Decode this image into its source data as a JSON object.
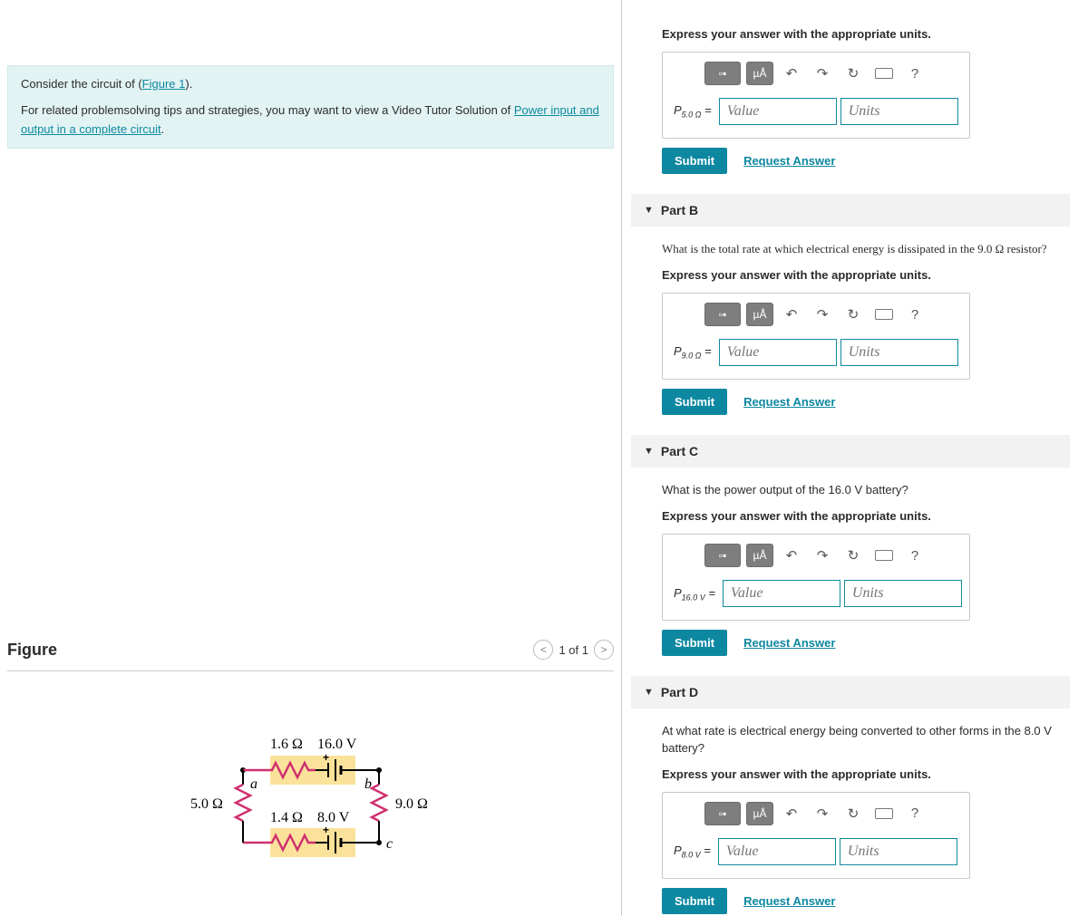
{
  "info": {
    "line1_a": "Consider the circuit of (",
    "figure_link": "Figure 1",
    "line1_b": ").",
    "line2_a": "For related problemsolving tips and strategies, you may want to view a Video Tutor Solution of ",
    "tutor_link": "Power input and output in a complete circuit",
    "line2_b": "."
  },
  "figure": {
    "title": "Figure",
    "pager": "1 of 1",
    "labels": {
      "top_r": "1.6 Ω",
      "top_v": "16.0 V",
      "bot_r": "1.4 Ω",
      "bot_v": "8.0 V",
      "left_r": "5.0 Ω",
      "right_r": "9.0 Ω",
      "a": "a",
      "b": "b",
      "c": "c"
    }
  },
  "common": {
    "units_hint": "Express your answer with the appropriate units.",
    "value_placeholder": "Value",
    "units_placeholder": "Units",
    "submit": "Submit",
    "request": "Request Answer",
    "mu": "µÅ",
    "help": "?"
  },
  "parts": {
    "a": {
      "var_html": "P<sub>5.0 Ω</sub> ="
    },
    "b": {
      "title": "Part B",
      "prompt": "What is the total rate at which electrical energy is dissipated in the 9.0 Ω resistor?",
      "var_html": "P<sub>9.0 Ω</sub> ="
    },
    "c": {
      "title": "Part C",
      "prompt": "What is the power output of the 16.0 V battery?",
      "var_html": "P<sub>16.0 V</sub> ="
    },
    "d": {
      "title": "Part D",
      "prompt": "At what rate is electrical energy being converted to other forms in the 8.0 V battery?",
      "var_html": "P<sub>8.0 V</sub> ="
    }
  }
}
